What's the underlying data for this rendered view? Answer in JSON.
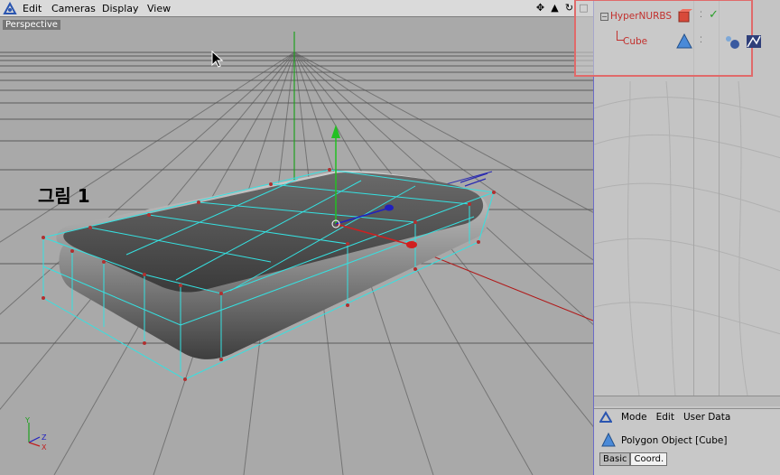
{
  "viewport": {
    "menu": [
      "Edit",
      "Cameras",
      "Display",
      "View"
    ],
    "label": "Perspective",
    "tool_icons": [
      "move-icon",
      "camera-icon",
      "rotate-icon",
      "maximize-icon"
    ],
    "annotation": "그림 1"
  },
  "object_manager": {
    "objects": [
      {
        "name": "HyperNURBS",
        "icon": "hypernurbs-icon"
      },
      {
        "name": "Cube",
        "icon": "polygon-icon"
      }
    ]
  },
  "attributes": {
    "menu": [
      "Mode",
      "Edit",
      "User Data"
    ],
    "title": "Polygon Object [Cube]",
    "tabs": [
      "Basic",
      "Coord."
    ]
  },
  "axis_labels": {
    "y": "Y",
    "z": "Z",
    "x": "X"
  },
  "colors": {
    "highlight": "#e06a6a",
    "cage": "#35e1e1",
    "object_label": "#c2302d"
  }
}
